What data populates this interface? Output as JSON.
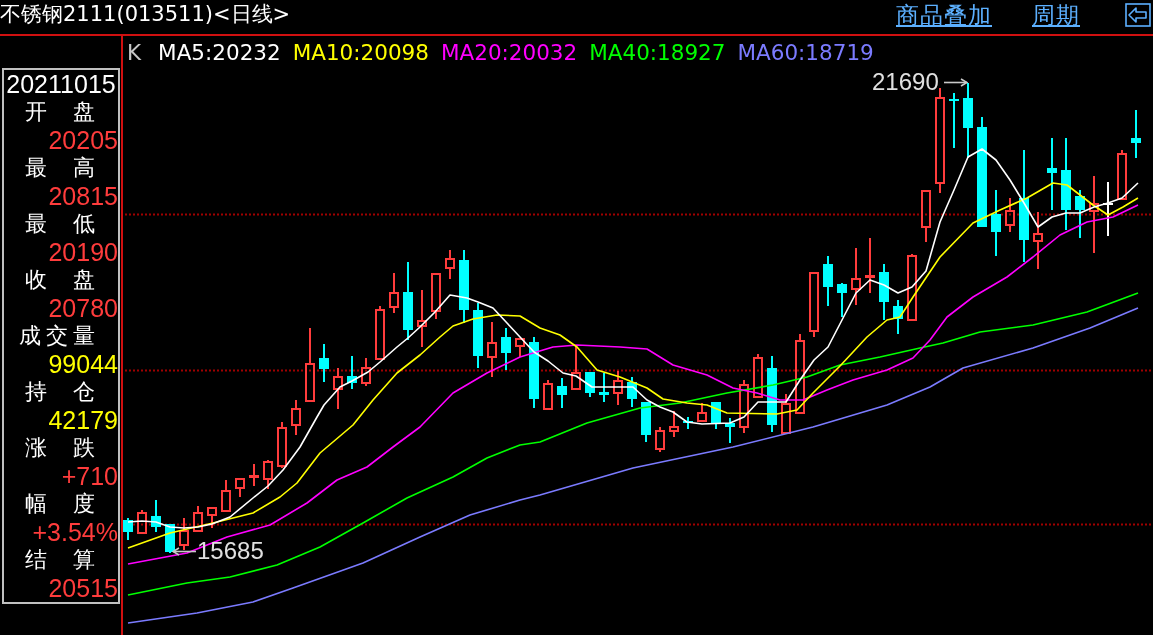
{
  "header": {
    "title": "不锈钢2111(013511)<日线>",
    "links": [
      {
        "label": "商品叠加"
      },
      {
        "label": "周期"
      }
    ]
  },
  "legend": {
    "label": "K",
    "items": [
      {
        "text": "MA5:20232",
        "color": "#ffffff"
      },
      {
        "text": "MA10:20098",
        "color": "#ffff00"
      },
      {
        "text": "MA20:20032",
        "color": "#ff00ff"
      },
      {
        "text": "MA40:18927",
        "color": "#00ff00"
      },
      {
        "text": "MA60:18719",
        "color": "#7b7bff"
      }
    ]
  },
  "quote_panel": {
    "date": "20211015",
    "fields": [
      {
        "label": "开 盘",
        "value": "20205",
        "color": "#ff3c3c"
      },
      {
        "label": "最 高",
        "value": "20815",
        "color": "#ff3c3c"
      },
      {
        "label": "最 低",
        "value": "20190",
        "color": "#ff3c3c"
      },
      {
        "label": "收 盘",
        "value": "20780",
        "color": "#ff3c3c"
      },
      {
        "label": "成交量",
        "value": "99044",
        "color": "#ffff00"
      },
      {
        "label": "持 仓",
        "value": "42179",
        "color": "#ffff00"
      },
      {
        "label": "涨 跌",
        "value": "+710",
        "color": "#ff3c3c"
      },
      {
        "label": "幅 度",
        "value": "+3.54%",
        "color": "#ff3c3c"
      },
      {
        "label": "结 算",
        "value": "20515",
        "color": "#ff3c3c"
      }
    ]
  },
  "chart": {
    "high_label": "21690",
    "low_label": "15685"
  }
}
